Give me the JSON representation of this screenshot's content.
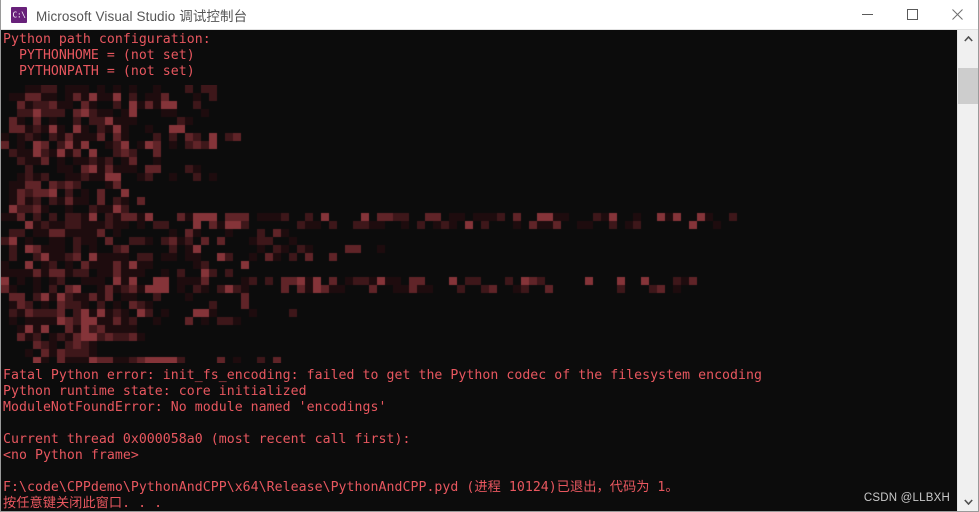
{
  "window": {
    "title": "Microsoft Visual Studio 调试控制台",
    "icon": "console-app-icon",
    "icon_glyph": "C:\\",
    "controls": {
      "minimize": "minimize-icon",
      "maximize": "maximize-icon",
      "close": "close-icon"
    }
  },
  "console": {
    "text_color": "#e8575f",
    "background_color": "#0c0c0c",
    "lines": [
      "Python path configuration:",
      "  PYTHONHOME = (not set)",
      "  PYTHONPATH = (not set)",
      "",
      "",
      "",
      "",
      "",
      "",
      "",
      "",
      "",
      "",
      "",
      "",
      "",
      "",
      "",
      "",
      "",
      "",
      "Fatal Python error: init_fs_encoding: failed to get the Python codec of the filesystem encoding",
      "Python runtime state: core initialized",
      "ModuleNotFoundError: No module named 'encodings'",
      "",
      "Current thread 0x000058a0 (most recent call first):",
      "<no Python frame>",
      "",
      "F:\\code\\CPPdemo\\PythonAndCPP\\x64\\Release\\PythonAndCPP.pyd (进程 10124)已退出，代码为 1。",
      "按任意键关闭此窗口. . ."
    ]
  },
  "censored_region": {
    "label": "mosaic-censored-output",
    "note": "pixelated block obscuring console output"
  },
  "watermark": {
    "text": "CSDN @LLBXH"
  },
  "scrollbar": {
    "up_arrow": "chevron-up-icon",
    "down_arrow": "chevron-down-icon",
    "thumb": "scrollbar-thumb"
  }
}
